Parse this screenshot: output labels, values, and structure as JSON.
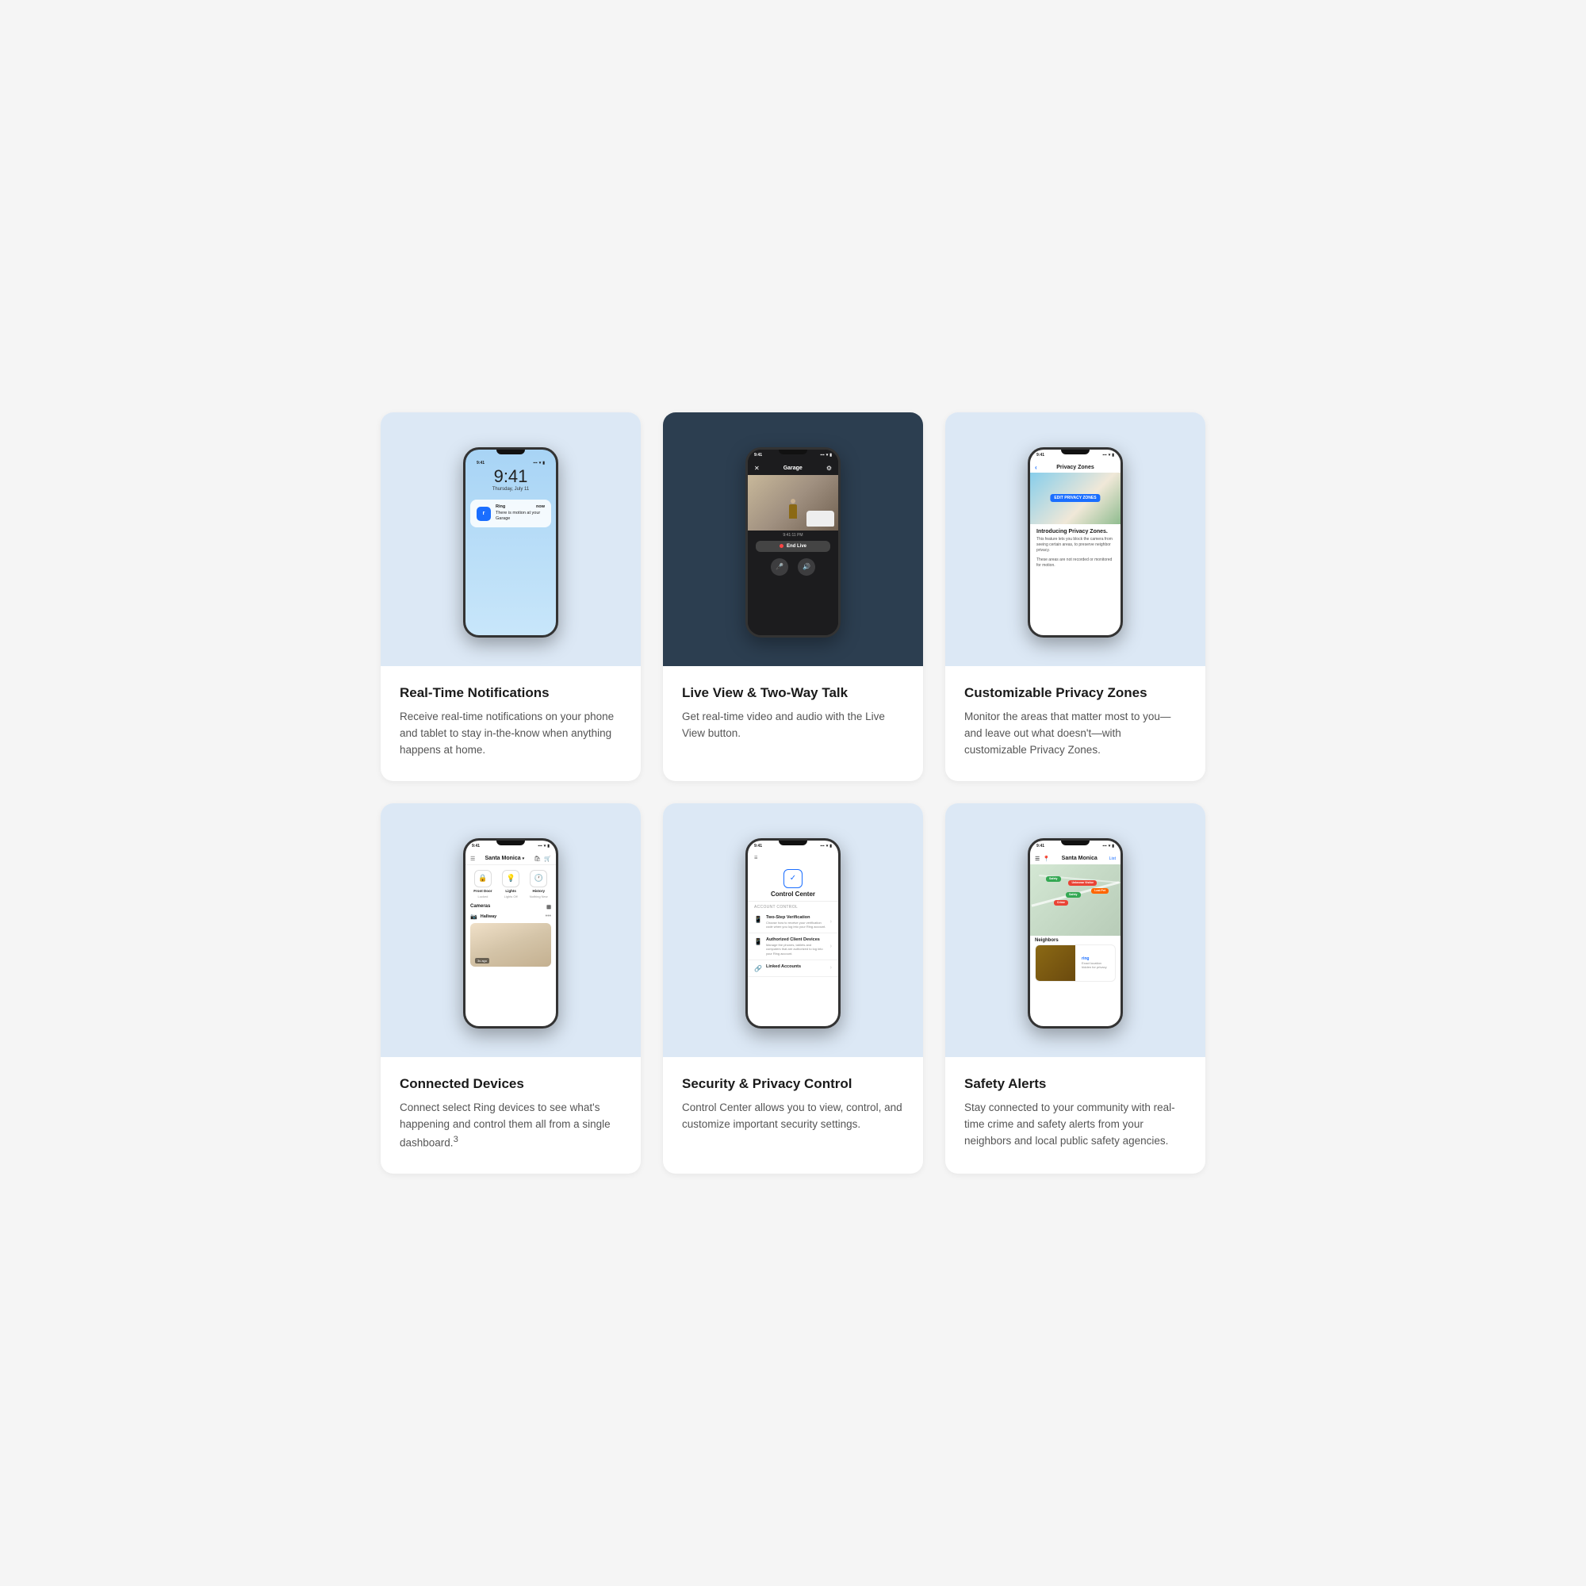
{
  "cards": [
    {
      "id": "real-time-notifications",
      "phone_type": "lockscreen",
      "title": "Real-Time Notifications",
      "description": "Receive real-time notifications on your phone and tablet to stay in-the-know when anything happens at home.",
      "phone": {
        "time": "9:41",
        "date": "Thursday, July 11",
        "app_name": "Ring",
        "notification": "There is motion at your Garage",
        "notif_time": "now"
      }
    },
    {
      "id": "live-view",
      "phone_type": "liveview",
      "title": "Live View & Two-Way Talk",
      "description": "Get real-time video and audio with the Live View button.",
      "phone": {
        "time": "9:41",
        "title": "Garage",
        "timestamp": "9:41:11 PM",
        "end_live_label": "End Live"
      }
    },
    {
      "id": "privacy-zones",
      "phone_type": "privacy",
      "title": "Customizable Privacy Zones",
      "description": "Monitor the areas that matter most to you—and leave out what doesn't—with customizable Privacy Zones.",
      "phone": {
        "time": "9:41",
        "screen_title": "Privacy Zones",
        "zone_label": "EDIT PRIVACY ZONES",
        "intro_title": "Introducing Privacy Zones.",
        "intro_body1": "This feature lets you block the camera from seeing certain areas, to preserve neighbor privacy.",
        "intro_body2": "These areas are not recorded or monitored for motion."
      }
    },
    {
      "id": "connected-devices",
      "phone_type": "connected",
      "title": "Connected Devices",
      "description": "Connect select Ring devices to see what's happening and control them all from a single dashboard.",
      "footnote": "3",
      "phone": {
        "time": "9:41",
        "location": "Santa Monica",
        "front_door": "Front Door",
        "front_door_status": "Locked",
        "lights": "Lights",
        "lights_status": "Lights Off",
        "history": "History",
        "history_status": "Nothing New",
        "cameras_section": "Cameras",
        "camera_name": "Hallway",
        "thumb_time": "3s ago"
      }
    },
    {
      "id": "security-privacy",
      "phone_type": "security",
      "title": "Security & Privacy Control",
      "description": "Control Center allows you to view, control, and customize important security settings.",
      "phone": {
        "time": "9:41",
        "screen_title": "Control Center",
        "account_control": "Account Control",
        "item1_title": "Two-Step Verification",
        "item1_desc": "Choose how to receive your verification code when you log into your Ring account.",
        "item2_title": "Authorized Client Devices",
        "item2_desc": "Manage the phones, tablets and computers that are authorized to log into your Ring account.",
        "item3_title": "Linked Accounts"
      }
    },
    {
      "id": "safety-alerts",
      "phone_type": "safety",
      "title": "Safety Alerts",
      "description": "Stay connected to your community with real-time crime and safety alerts from your neighbors and local public safety agencies.",
      "phone": {
        "time": "9:41",
        "location": "Santa Monica",
        "list_label": "List",
        "neighbors_title": "Neighbors",
        "privacy_note": "Exact location hidden for privacy",
        "badge1": "Safety",
        "badge2": "Safety",
        "badge3": "Crime",
        "badge4": "Unknown Visitor",
        "badge5": "Lost Pet"
      }
    }
  ]
}
